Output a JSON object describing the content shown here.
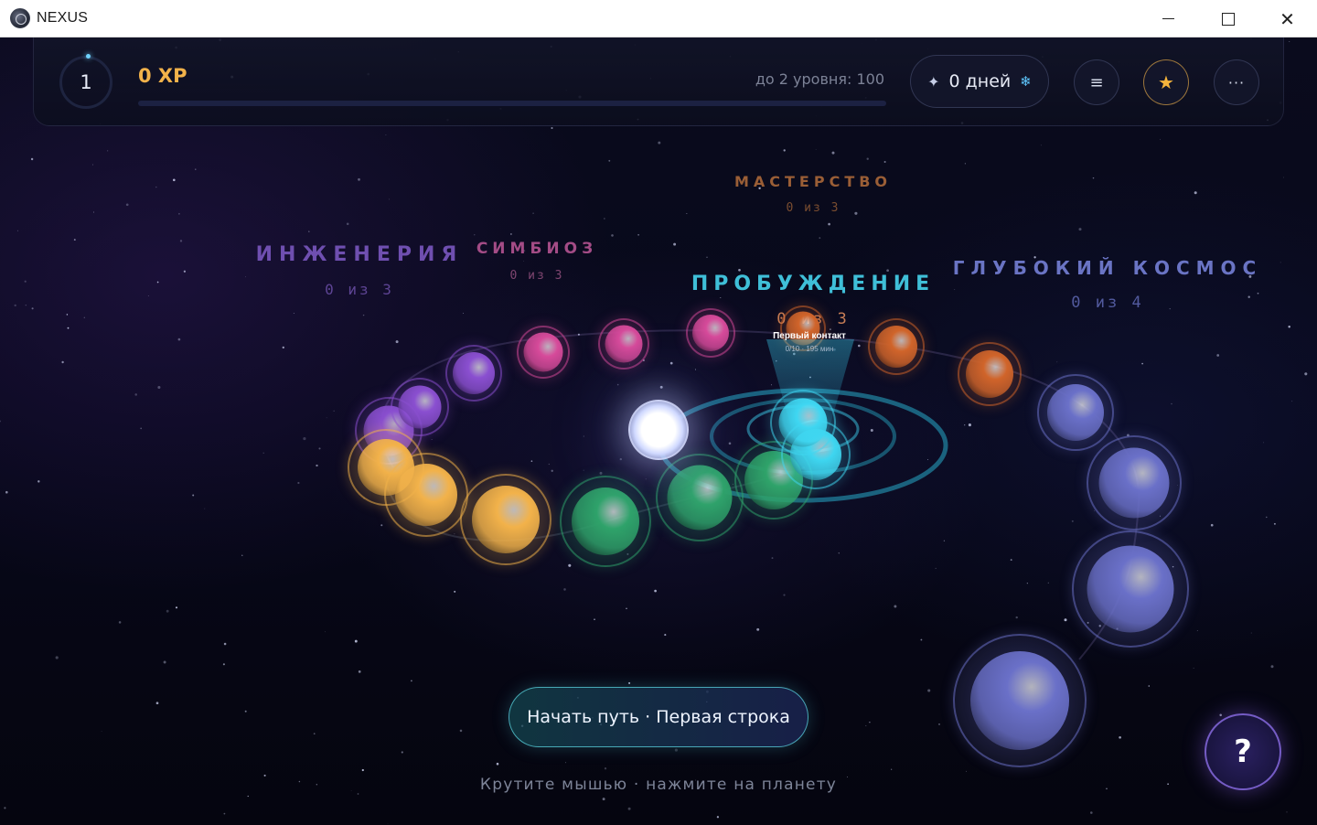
{
  "window": {
    "title": "NEXUS"
  },
  "hud": {
    "level": "1",
    "xp": "0 XP",
    "next_level": "до 2 уровня: 100",
    "xp_progress": 0,
    "streak": "0 дней",
    "menu_icon": "≡",
    "star_icon": "★",
    "more_icon": "···"
  },
  "clusters": [
    {
      "name": "ИНЖЕНЕРИЯ",
      "count": "0 из 3",
      "color": "#6f4fb0"
    },
    {
      "name": "СИМБИОЗ",
      "count": "0 из 3",
      "color": "#b04f8f"
    },
    {
      "name": "МАСТЕРСТВО",
      "count": "0 из 3",
      "color": "#a66a3a"
    },
    {
      "name": "ПРОБУЖДЕНИЕ",
      "count": "0 из 3",
      "color": "#3fbfd8"
    },
    {
      "name": "ГЛУБОКИЙ КОСМОС",
      "count": "0 из 4",
      "color": "#6a74c4"
    }
  ],
  "focused_planet": {
    "name": "Первый контакт",
    "meta": "0/10 · 195 мин"
  },
  "cta": {
    "label": "Начать путь · Первая строка"
  },
  "hint": "Крутите мышью · нажмите на планету",
  "help": "?",
  "colors": {
    "gold": "#f2b24a",
    "cyan": "#3fd6f0",
    "green": "#2fa36a",
    "pink": "#d64a9a",
    "purple": "#8a4fd0",
    "orange": "#d0642a",
    "indigo": "#6a70c8"
  }
}
